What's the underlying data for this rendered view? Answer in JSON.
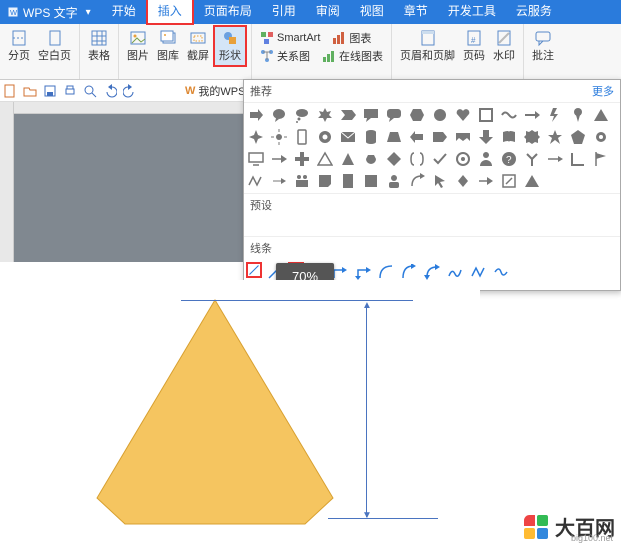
{
  "app": {
    "name": "WPS 文字",
    "arrow": "▾"
  },
  "menu": {
    "items": [
      "开始",
      "插入",
      "页面布局",
      "引用",
      "审阅",
      "视图",
      "章节",
      "开发工具",
      "云服务"
    ],
    "active_index": 1
  },
  "ribbon": {
    "group1": {
      "paginate": "分页",
      "blank": "空白页"
    },
    "group2": {
      "table": "表格"
    },
    "group3": {
      "pic": "图片",
      "gallery": "图库",
      "screenshot": "截屏",
      "shapes": "形状"
    },
    "group4_small": {
      "smartart": "SmartArt",
      "chart": "图表",
      "relation": "关系图",
      "onlinechart": "在线图表"
    },
    "group5": {
      "headerfooter": "页眉和页脚",
      "pagenum": "页码",
      "watermark": "水印"
    },
    "group6": {
      "comment": "批注"
    }
  },
  "qat": {
    "wps_tab": "我的WPS"
  },
  "shape_panel": {
    "recommend": "推荐",
    "more": "更多",
    "preset": "预设",
    "lines": "线条"
  },
  "tooltip": {
    "zoom": "70%"
  },
  "watermark": {
    "title": "大百网",
    "url": "big100.net"
  }
}
